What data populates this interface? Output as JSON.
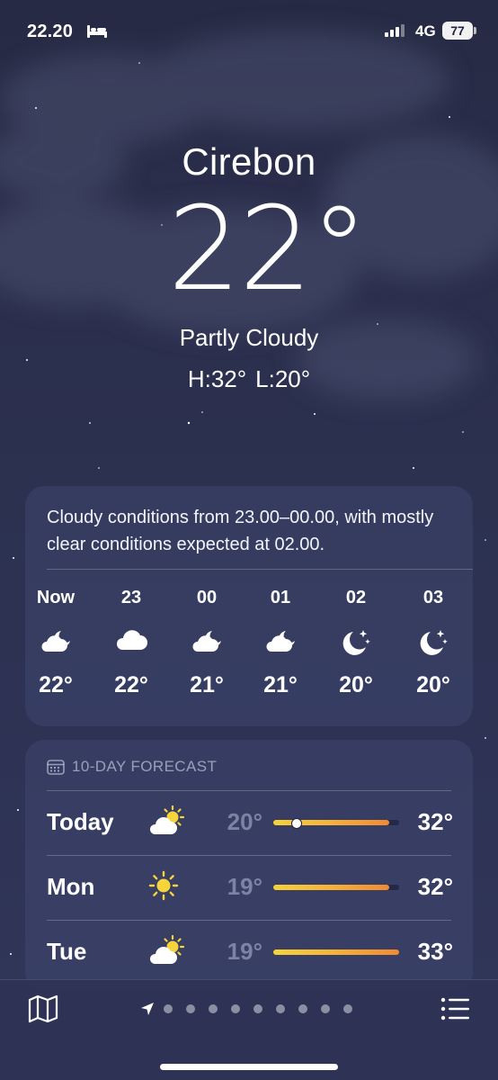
{
  "status_bar": {
    "time": "22.20",
    "network": "4G",
    "battery": "77"
  },
  "location": {
    "city": "Cirebon",
    "temperature": "22°",
    "condition": "Partly Cloudy",
    "high": "H:32°",
    "low": "L:20°"
  },
  "hourly": {
    "summary": "Cloudy conditions from 23.00–00.00, with mostly clear conditions expected at 02.00.",
    "hours": [
      {
        "label": "Now",
        "icon": "cloud-moon-icon",
        "temp": "22°"
      },
      {
        "label": "23",
        "icon": "cloud-icon",
        "temp": "22°"
      },
      {
        "label": "00",
        "icon": "cloud-moon-icon",
        "temp": "21°"
      },
      {
        "label": "01",
        "icon": "cloud-moon-icon",
        "temp": "21°"
      },
      {
        "label": "02",
        "icon": "moon-stars-icon",
        "temp": "20°"
      },
      {
        "label": "03",
        "icon": "moon-stars-icon",
        "temp": "20°"
      }
    ]
  },
  "forecast": {
    "title": "10-DAY FORECAST",
    "days": [
      {
        "day": "Today",
        "icon": "partly-sunny-icon",
        "low": "20°",
        "high": "32°",
        "range_start": 0.0,
        "range_end": 0.92,
        "current_marker": 0.18
      },
      {
        "day": "Mon",
        "icon": "sun-icon",
        "low": "19°",
        "high": "32°",
        "range_start": 0.0,
        "range_end": 0.92
      },
      {
        "day": "Tue",
        "icon": "partly-sunny-icon",
        "low": "19°",
        "high": "33°",
        "range_start": 0.0,
        "range_end": 1.0
      }
    ]
  },
  "bottom_bar": {
    "page_count": 9
  }
}
